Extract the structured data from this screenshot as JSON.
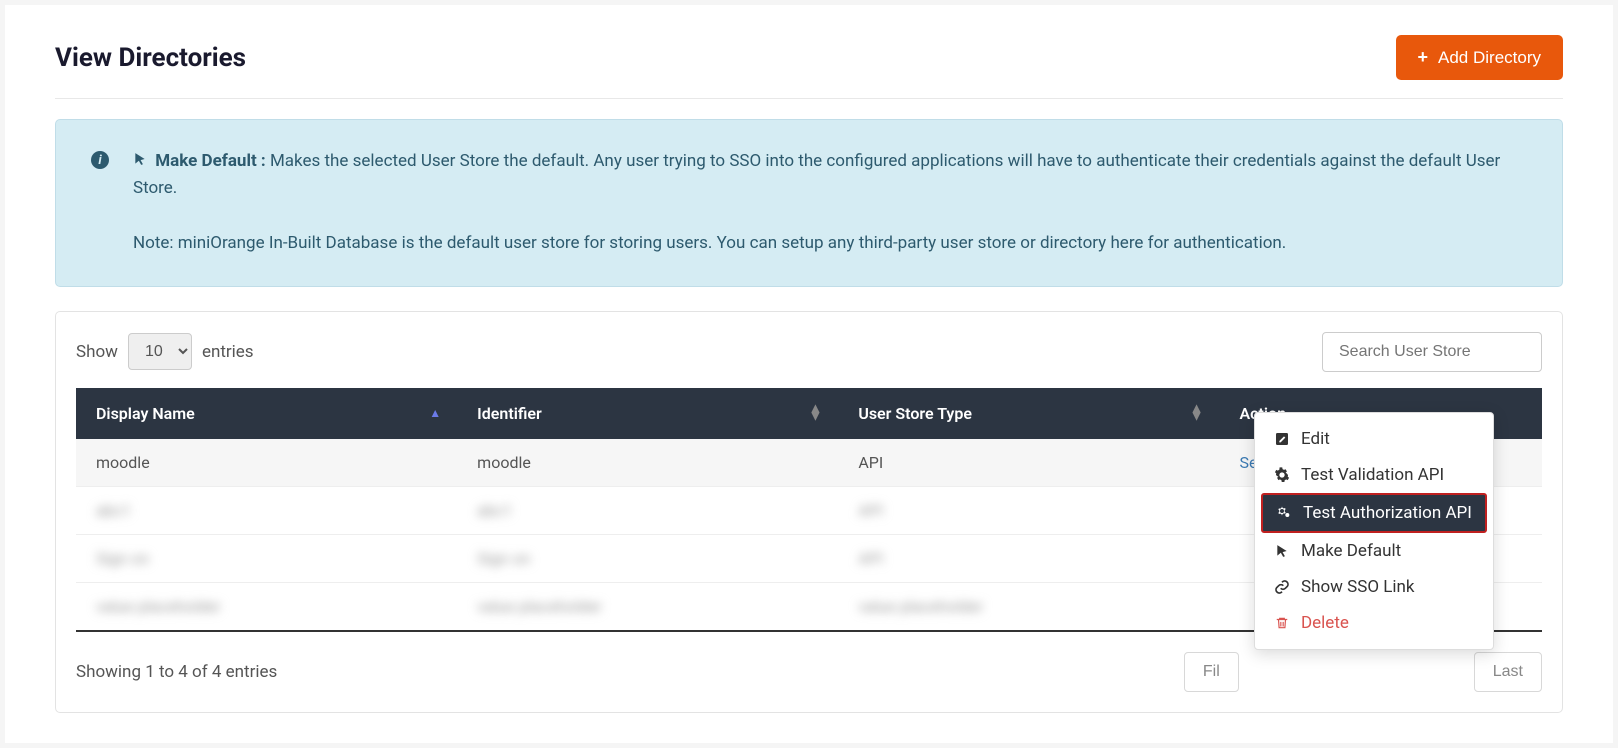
{
  "header": {
    "title": "View Directories",
    "add_button": "Add Directory"
  },
  "info": {
    "make_default_label": "Make Default :",
    "make_default_text": "Makes the selected User Store the default. Any user trying to SSO into the configured applications will have to authenticate their credentials against the default User Store.",
    "note": "Note: miniOrange In-Built Database is the default user store for storing users. You can setup any third-party user store or directory here for authentication."
  },
  "table": {
    "show_label": "Show",
    "entries_label": "entries",
    "page_size": "10",
    "search_placeholder": "Search User Store",
    "columns": {
      "display_name": "Display Name",
      "identifier": "Identifier",
      "user_store_type": "User Store Type",
      "action": "Action"
    },
    "rows": [
      {
        "display_name": "moodle",
        "identifier": "moodle",
        "type": "API",
        "action_label": "Select",
        "blurred": false
      },
      {
        "display_name": "abc1",
        "identifier": "abc1",
        "type": "API",
        "action_label": "",
        "blurred": true
      },
      {
        "display_name": "Sign on",
        "identifier": "Sign on",
        "type": "API",
        "action_label": "",
        "blurred": true
      },
      {
        "display_name": "value placeholder",
        "identifier": "value placeholder",
        "type": "value placeholder",
        "action_label": "",
        "blurred": true
      }
    ],
    "showing_text": "Showing 1 to 4 of 4 entries",
    "pager": {
      "first": "Fil",
      "last": "Last"
    }
  },
  "dropdown": {
    "edit": "Edit",
    "test_validation": "Test Validation API",
    "test_authorization": "Test Authorization API",
    "make_default": "Make Default",
    "show_sso": "Show SSO Link",
    "delete": "Delete"
  }
}
